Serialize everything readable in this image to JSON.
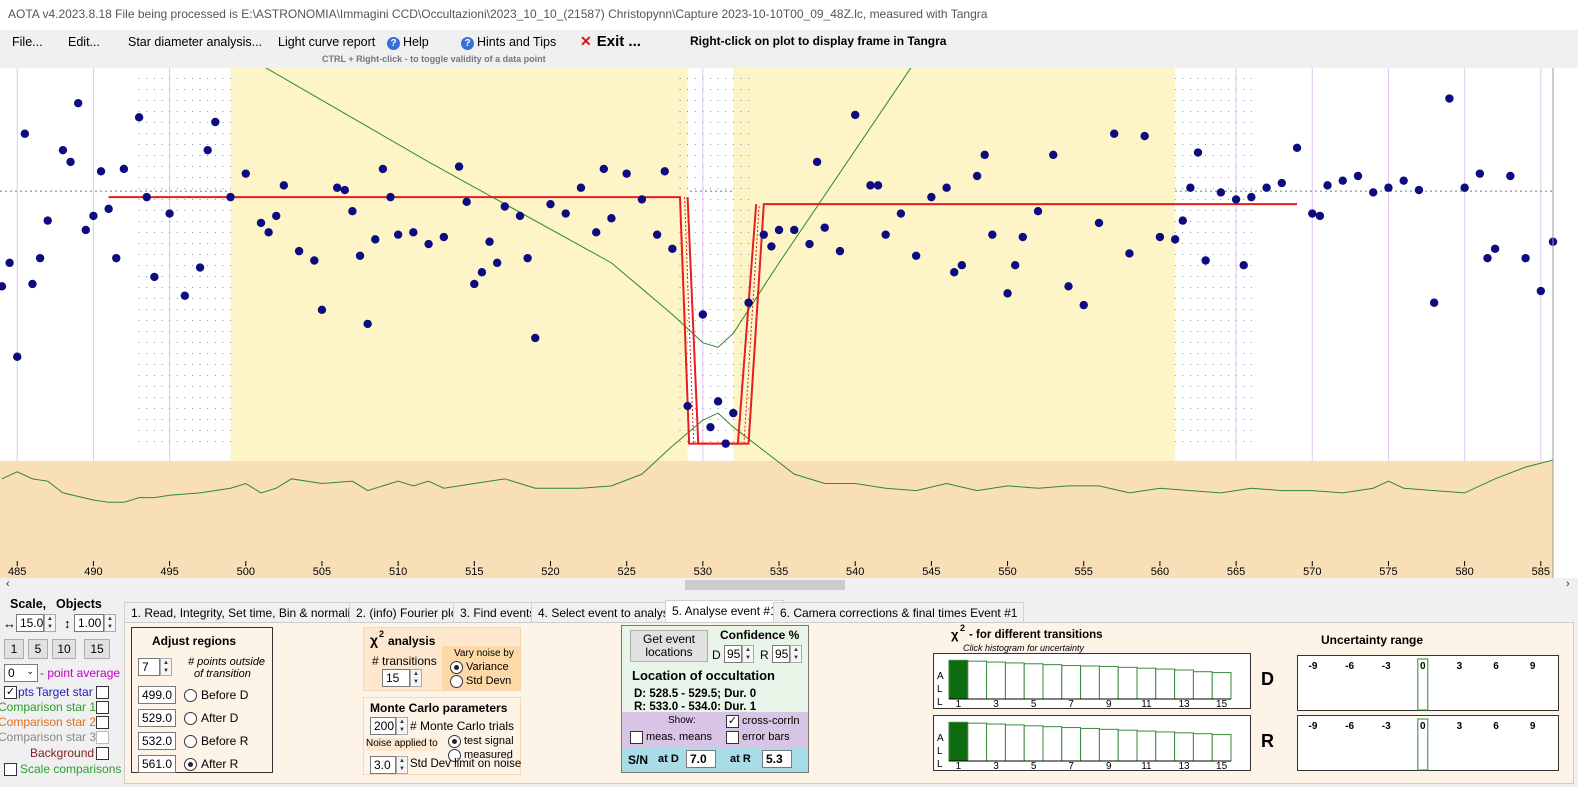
{
  "titlebar": {
    "text": "AOTA v4.2023.8.18   File being processed is E:\\ASTRONOMIA\\Immagini CCD\\Occultazioni\\2023_10_10_(21587) Christopynn\\Capture 2023-10-10T00_09_48Z.lc, measured with Tangra"
  },
  "menu": {
    "file": "File...",
    "edit": "Edit...",
    "star_diameter": "Star diameter analysis...",
    "light_curve": "Light curve report",
    "help": "Help",
    "hints": "Hints and Tips",
    "exit": "Exit ...",
    "hint_right_click": "Right-click on plot to display frame in Tangra",
    "hint_ctrl": "CTRL + Right-click  -  to toggle validity of a data point"
  },
  "chart_data": {
    "type": "scatter",
    "x_ticks": [
      485,
      490,
      495,
      500,
      505,
      510,
      515,
      520,
      525,
      530,
      535,
      540,
      545,
      550,
      555,
      560,
      565,
      570,
      575,
      580,
      585
    ],
    "xlim": [
      484,
      585.8
    ],
    "ylim": [
      -0.55,
      1.55
    ],
    "regions": {
      "before_d": [
        499.0,
        529.0
      ],
      "after_r": [
        532.0,
        561.0
      ]
    },
    "model": {
      "upper": 1.0,
      "lower": -0.05,
      "d_start": 528.5,
      "d_end": 529.0,
      "r_start": 533.0,
      "r_end": 534.0,
      "x_start": 491.0,
      "x_end": 569.0,
      "upper_r": 0.97
    },
    "points": [
      {
        "x": 484,
        "y": 0.62
      },
      {
        "x": 484.5,
        "y": 0.72
      },
      {
        "x": 485,
        "y": 0.32
      },
      {
        "x": 485.5,
        "y": 1.27
      },
      {
        "x": 486,
        "y": 0.63
      },
      {
        "x": 486.5,
        "y": 0.74
      },
      {
        "x": 487,
        "y": 0.9
      },
      {
        "x": 488,
        "y": 1.2
      },
      {
        "x": 488.5,
        "y": 1.15
      },
      {
        "x": 489,
        "y": 1.4
      },
      {
        "x": 489.5,
        "y": 0.86
      },
      {
        "x": 490,
        "y": 0.92
      },
      {
        "x": 490.5,
        "y": 1.11
      },
      {
        "x": 491,
        "y": 0.95
      },
      {
        "x": 491.5,
        "y": 0.74
      },
      {
        "x": 492,
        "y": 1.12
      },
      {
        "x": 493,
        "y": 1.34
      },
      {
        "x": 493.5,
        "y": 1.0
      },
      {
        "x": 494,
        "y": 0.66
      },
      {
        "x": 495,
        "y": 0.93
      },
      {
        "x": 496,
        "y": 0.58
      },
      {
        "x": 497,
        "y": 0.7
      },
      {
        "x": 497.5,
        "y": 1.2
      },
      {
        "x": 498,
        "y": 1.32
      },
      {
        "x": 499,
        "y": 1.0
      },
      {
        "x": 500,
        "y": 1.1
      },
      {
        "x": 501,
        "y": 0.89
      },
      {
        "x": 501.5,
        "y": 0.85
      },
      {
        "x": 502,
        "y": 0.92
      },
      {
        "x": 502.5,
        "y": 1.05
      },
      {
        "x": 503.5,
        "y": 0.77
      },
      {
        "x": 504.5,
        "y": 0.73
      },
      {
        "x": 505,
        "y": 0.52
      },
      {
        "x": 506,
        "y": 1.04
      },
      {
        "x": 506.5,
        "y": 1.03
      },
      {
        "x": 507,
        "y": 0.94
      },
      {
        "x": 507.5,
        "y": 0.75
      },
      {
        "x": 508,
        "y": 0.46
      },
      {
        "x": 508.5,
        "y": 0.82
      },
      {
        "x": 509,
        "y": 1.12
      },
      {
        "x": 509.5,
        "y": 1.0
      },
      {
        "x": 510,
        "y": 0.84
      },
      {
        "x": 511,
        "y": 0.85
      },
      {
        "x": 512,
        "y": 0.8
      },
      {
        "x": 513,
        "y": 0.83
      },
      {
        "x": 514,
        "y": 1.13
      },
      {
        "x": 514.5,
        "y": 0.98
      },
      {
        "x": 515,
        "y": 0.63
      },
      {
        "x": 515.5,
        "y": 0.68
      },
      {
        "x": 516,
        "y": 0.81
      },
      {
        "x": 516.5,
        "y": 0.72
      },
      {
        "x": 517,
        "y": 0.96
      },
      {
        "x": 518,
        "y": 0.92
      },
      {
        "x": 518.5,
        "y": 0.74
      },
      {
        "x": 519,
        "y": 0.4
      },
      {
        "x": 520,
        "y": 0.97
      },
      {
        "x": 521,
        "y": 0.93
      },
      {
        "x": 522,
        "y": 1.04
      },
      {
        "x": 523,
        "y": 0.85
      },
      {
        "x": 523.5,
        "y": 1.12
      },
      {
        "x": 524,
        "y": 0.91
      },
      {
        "x": 525,
        "y": 1.1
      },
      {
        "x": 526,
        "y": 0.99
      },
      {
        "x": 527,
        "y": 0.84
      },
      {
        "x": 527.5,
        "y": 1.11
      },
      {
        "x": 528,
        "y": 0.78
      },
      {
        "x": 529,
        "y": 0.11
      },
      {
        "x": 530,
        "y": 0.5
      },
      {
        "x": 530.5,
        "y": 0.02
      },
      {
        "x": 531,
        "y": 0.13
      },
      {
        "x": 531.5,
        "y": -0.05
      },
      {
        "x": 532,
        "y": 0.08
      },
      {
        "x": 533,
        "y": 0.55
      },
      {
        "x": 534,
        "y": 0.84
      },
      {
        "x": 534.5,
        "y": 0.79
      },
      {
        "x": 535,
        "y": 0.86
      },
      {
        "x": 536,
        "y": 0.86
      },
      {
        "x": 537,
        "y": 0.8
      },
      {
        "x": 537.5,
        "y": 1.15
      },
      {
        "x": 538,
        "y": 0.87
      },
      {
        "x": 539,
        "y": 0.77
      },
      {
        "x": 540,
        "y": 1.35
      },
      {
        "x": 541,
        "y": 1.05
      },
      {
        "x": 541.5,
        "y": 1.05
      },
      {
        "x": 542,
        "y": 0.84
      },
      {
        "x": 543,
        "y": 0.93
      },
      {
        "x": 544,
        "y": 0.75
      },
      {
        "x": 545,
        "y": 1.0
      },
      {
        "x": 546,
        "y": 1.04
      },
      {
        "x": 546.5,
        "y": 0.68
      },
      {
        "x": 547,
        "y": 0.71
      },
      {
        "x": 548,
        "y": 1.09
      },
      {
        "x": 548.5,
        "y": 1.18
      },
      {
        "x": 549,
        "y": 0.84
      },
      {
        "x": 550,
        "y": 0.59
      },
      {
        "x": 550.5,
        "y": 0.71
      },
      {
        "x": 551,
        "y": 0.83
      },
      {
        "x": 552,
        "y": 0.94
      },
      {
        "x": 553,
        "y": 1.18
      },
      {
        "x": 554,
        "y": 0.62
      },
      {
        "x": 555,
        "y": 0.54
      },
      {
        "x": 556,
        "y": 0.89
      },
      {
        "x": 557,
        "y": 1.27
      },
      {
        "x": 558,
        "y": 0.76
      },
      {
        "x": 559,
        "y": 1.26
      },
      {
        "x": 560,
        "y": 0.83
      },
      {
        "x": 561,
        "y": 0.82
      },
      {
        "x": 561.5,
        "y": 0.9
      },
      {
        "x": 562,
        "y": 1.04
      },
      {
        "x": 562.5,
        "y": 1.19
      },
      {
        "x": 563,
        "y": 0.73
      },
      {
        "x": 564,
        "y": 1.02
      },
      {
        "x": 565,
        "y": 0.99
      },
      {
        "x": 565.5,
        "y": 0.71
      },
      {
        "x": 566,
        "y": 1.0
      },
      {
        "x": 567,
        "y": 1.04
      },
      {
        "x": 568,
        "y": 1.06
      },
      {
        "x": 569,
        "y": 1.21
      },
      {
        "x": 570,
        "y": 0.93
      },
      {
        "x": 570.5,
        "y": 0.92
      },
      {
        "x": 571,
        "y": 1.05
      },
      {
        "x": 572,
        "y": 1.07
      },
      {
        "x": 573,
        "y": 1.09
      },
      {
        "x": 574,
        "y": 1.02
      },
      {
        "x": 575,
        "y": 1.04
      },
      {
        "x": 576,
        "y": 1.07
      },
      {
        "x": 577,
        "y": 1.03
      },
      {
        "x": 578,
        "y": 0.55
      },
      {
        "x": 579,
        "y": 1.42
      },
      {
        "x": 580,
        "y": 1.04
      },
      {
        "x": 581,
        "y": 1.1
      },
      {
        "x": 581.5,
        "y": 0.74
      },
      {
        "x": 582,
        "y": 0.78
      },
      {
        "x": 583,
        "y": 1.09
      },
      {
        "x": 584,
        "y": 0.74
      },
      {
        "x": 585,
        "y": 0.6
      },
      {
        "x": 585.8,
        "y": 0.81
      }
    ],
    "chi_line": [
      [
        488,
        2.0
      ],
      [
        500,
        1.6
      ],
      [
        512,
        1.15
      ],
      [
        524,
        0.72
      ],
      [
        528,
        0.5
      ],
      [
        530,
        0.38
      ],
      [
        531,
        0.36
      ],
      [
        532,
        0.42
      ],
      [
        535,
        0.72
      ],
      [
        540,
        1.2
      ],
      [
        545,
        1.68
      ],
      [
        550,
        2.0
      ]
    ],
    "noise_line": [
      [
        484,
        -0.2
      ],
      [
        485,
        -0.17
      ],
      [
        486,
        -0.2
      ],
      [
        487,
        -0.21
      ],
      [
        488,
        -0.26
      ],
      [
        490,
        -0.29
      ],
      [
        491,
        -0.3
      ],
      [
        492,
        -0.3
      ],
      [
        493,
        -0.28
      ],
      [
        494,
        -0.28
      ],
      [
        495,
        -0.27
      ],
      [
        497,
        -0.26
      ],
      [
        499,
        -0.24
      ],
      [
        500,
        -0.22
      ],
      [
        501,
        -0.26
      ],
      [
        502,
        -0.24
      ],
      [
        503,
        -0.2
      ],
      [
        505,
        -0.22
      ],
      [
        507,
        -0.21
      ],
      [
        508,
        -0.25
      ],
      [
        510,
        -0.21
      ],
      [
        511,
        -0.23
      ],
      [
        512,
        -0.21
      ],
      [
        513,
        -0.24
      ],
      [
        515,
        -0.22
      ],
      [
        517,
        -0.2
      ],
      [
        519,
        -0.24
      ],
      [
        522,
        -0.24
      ],
      [
        524,
        -0.23
      ],
      [
        526,
        -0.18
      ],
      [
        528,
        -0.06
      ],
      [
        530,
        0.05
      ],
      [
        531,
        0.08
      ],
      [
        532,
        0.02
      ],
      [
        534,
        -0.08
      ],
      [
        536,
        -0.18
      ],
      [
        538,
        -0.22
      ],
      [
        540,
        -0.22
      ],
      [
        542,
        -0.24
      ],
      [
        544,
        -0.25
      ],
      [
        546,
        -0.22
      ],
      [
        548,
        -0.25
      ],
      [
        550,
        -0.23
      ],
      [
        552,
        -0.24
      ],
      [
        554,
        -0.23
      ],
      [
        556,
        -0.23
      ],
      [
        558,
        -0.26
      ],
      [
        560,
        -0.24
      ],
      [
        562,
        -0.25
      ],
      [
        564,
        -0.26
      ],
      [
        566,
        -0.24
      ],
      [
        568,
        -0.25
      ],
      [
        570,
        -0.25
      ],
      [
        572,
        -0.26
      ],
      [
        574,
        -0.24
      ],
      [
        575,
        -0.21
      ],
      [
        576,
        -0.24
      ],
      [
        578,
        -0.25
      ],
      [
        580,
        -0.26
      ],
      [
        582,
        -0.2
      ],
      [
        584,
        -0.15
      ],
      [
        585.8,
        -0.12
      ]
    ]
  },
  "scale": {
    "title": "Scale,",
    "objects": "Objects",
    "h_value": "15.0",
    "v_value": "1.00",
    "btn1": "1",
    "btn5": "5",
    "btn10": "10",
    "btn15": "15",
    "avg_value": "0",
    "avg_label": "- point average",
    "pts": "pts",
    "target": "Target star",
    "comp1": "Comparison star 1",
    "comp2": "Comparison star 2",
    "comp3": "Comparison star 3",
    "background": "Background",
    "scale_comp": "Scale comparisons"
  },
  "tabs": [
    "1. Read, Integrity, Set time, Bin & normalise",
    "2. (info)  Fourier plot",
    "3. Find events",
    "4. Select event to analyse",
    "5. Analyse event #1",
    "6. Camera corrections & final times Event #1"
  ],
  "adjust": {
    "title": "Adjust regions",
    "points_val": "7",
    "points_lbl1": "# points outside",
    "points_lbl2": "of transition",
    "before_d_val": "499.0",
    "before_d": "Before D",
    "after_d_val": "529.0",
    "after_d": "After D",
    "before_r_val": "532.0",
    "before_r": "Before R",
    "after_r_val": "561.0",
    "after_r": "After R"
  },
  "chi2": {
    "title": "analysis",
    "chi": "χ",
    "sup": "2",
    "transitions_lbl": "# transitions",
    "transitions_val": "15",
    "vary_lbl1": "Vary noise by",
    "variance": "Variance",
    "stddev": "Std Devn"
  },
  "monte": {
    "title": "Monte Carlo parameters",
    "trials_val": "200",
    "trials_lbl": "# Monte Carlo trials",
    "noise_lbl": "Noise applied to",
    "test_signal": "test signal",
    "measured": "measured",
    "std_val": "3.0",
    "std_lbl": "Std Dev limit on noise"
  },
  "event": {
    "btn1": "Get event",
    "btn2": "locations",
    "conf": "Confidence %",
    "d_lbl": "D",
    "d_val": "95",
    "r_lbl": "R",
    "r_val": "95",
    "loc_title": "Location of occultation",
    "d_line": "D: 528.5 - 529.5; Dur. 0",
    "r_line": "R: 533.0 - 534.0; Dur. 1",
    "show": "Show:",
    "cross": "cross-corrln",
    "means": "meas. means",
    "errbars": "error bars",
    "sn": "S/N",
    "at_d": "at D",
    "sn_d": "7.0",
    "at_r": "at R",
    "sn_r": "5.3"
  },
  "hist": {
    "title": "- for different transitions",
    "sub": "Click histogram for uncertainty",
    "a": "A",
    "l1": "L",
    "l2": "L",
    "labels": [
      "1",
      "3",
      "5",
      "7",
      "9",
      "11",
      "13",
      "15"
    ],
    "d": "D",
    "r": "R",
    "bars_d": [
      0.88,
      0.86,
      0.84,
      0.82,
      0.8,
      0.78,
      0.76,
      0.75,
      0.74,
      0.72,
      0.7,
      0.68,
      0.66,
      0.62,
      0.6
    ],
    "bars_r": [
      0.88,
      0.86,
      0.84,
      0.82,
      0.8,
      0.78,
      0.76,
      0.74,
      0.72,
      0.7,
      0.68,
      0.66,
      0.64,
      0.62,
      0.6
    ]
  },
  "uncert": {
    "title": "Uncertainty range",
    "labels": [
      "-9",
      "-6",
      "-3",
      "0",
      "3",
      "6",
      "9"
    ]
  }
}
